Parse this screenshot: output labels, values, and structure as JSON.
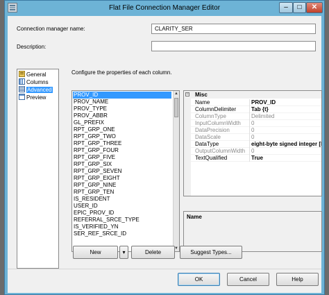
{
  "window": {
    "title": "Flat File Connection Manager Editor",
    "minimize_glyph": "–",
    "maximize_glyph": "□",
    "close_glyph": "✕"
  },
  "form": {
    "connection_name_label": "Connection manager name:",
    "connection_name_value": "CLARITY_SER",
    "description_label": "Description:",
    "description_value": ""
  },
  "nav": {
    "items": [
      {
        "label": "General",
        "icon": "general-icon"
      },
      {
        "label": "Columns",
        "icon": "columns-icon"
      },
      {
        "label": "Advanced",
        "icon": "advanced-icon",
        "selected": true
      },
      {
        "label": "Preview",
        "icon": "preview-icon"
      }
    ]
  },
  "main": {
    "instruction": "Configure the properties of each column."
  },
  "columns": {
    "selected": "PROV_ID",
    "items": [
      "PROV_ID",
      "PROV_NAME",
      "PROV_TYPE",
      "PROV_ABBR",
      "GL_PREFIX",
      "RPT_GRP_ONE",
      "RPT_GRP_TWO",
      "RPT_GRP_THREE",
      "RPT_GRP_FOUR",
      "RPT_GRP_FIVE",
      "RPT_GRP_SIX",
      "RPT_GRP_SEVEN",
      "RPT_GRP_EIGHT",
      "RPT_GRP_NINE",
      "RPT_GRP_TEN",
      "IS_RESIDENT",
      "USER_ID",
      "EPIC_PROV_ID",
      "REFERRAL_SRCE_TYPE",
      "IS_VERIFIED_YN",
      "SER_REF_SRCE_ID"
    ]
  },
  "properties": {
    "category": "Misc",
    "category_toggle": "−",
    "rows": [
      {
        "name": "Name",
        "value": "PROV_ID",
        "style": "bold"
      },
      {
        "name": "ColumnDelimiter",
        "value": "Tab {t}",
        "style": "bold"
      },
      {
        "name": "ColumnType",
        "value": "Delimited",
        "style": "gray"
      },
      {
        "name": "InputColumnWidth",
        "value": "0",
        "style": "gray"
      },
      {
        "name": "DataPrecision",
        "value": "0",
        "style": "gray"
      },
      {
        "name": "DataScale",
        "value": "0",
        "style": "gray"
      },
      {
        "name": "DataType",
        "value": "eight-byte signed integer [D",
        "style": "bold"
      },
      {
        "name": "OutputColumnWidth",
        "value": "0",
        "style": "gray"
      },
      {
        "name": "TextQualified",
        "value": "True",
        "style": "bold"
      }
    ],
    "description_title": "Name"
  },
  "buttons": {
    "new": "New",
    "new_dropdown": "▾",
    "delete": "Delete",
    "suggest_types": "Suggest Types...",
    "ok": "OK",
    "cancel": "Cancel",
    "help": "Help"
  },
  "colors": {
    "selection": "#3399ff",
    "frame": "#6db3d6",
    "close_button": "#c0412a"
  }
}
